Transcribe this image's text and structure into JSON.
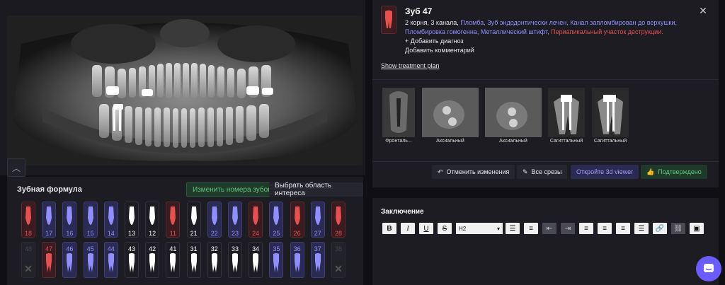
{
  "formula": {
    "title": "Зубная формула",
    "change_numbers_label": "Изменить номера зубов",
    "select_area_label": "Выбрать область интереса",
    "upper": [
      {
        "num": "18",
        "status": "red"
      },
      {
        "num": "17",
        "status": "purple"
      },
      {
        "num": "16",
        "status": "purple"
      },
      {
        "num": "15",
        "status": "purple"
      },
      {
        "num": "14",
        "status": "purple"
      },
      {
        "num": "13",
        "status": "white"
      },
      {
        "num": "12",
        "status": "white"
      },
      {
        "num": "11",
        "status": "red"
      },
      {
        "num": "21",
        "status": "white"
      },
      {
        "num": "22",
        "status": "purple"
      },
      {
        "num": "23",
        "status": "purple"
      },
      {
        "num": "24",
        "status": "red"
      },
      {
        "num": "25",
        "status": "purple"
      },
      {
        "num": "26",
        "status": "red"
      },
      {
        "num": "27",
        "status": "purple"
      },
      {
        "num": "28",
        "status": "red"
      }
    ],
    "lower": [
      {
        "num": "48",
        "status": "missing"
      },
      {
        "num": "47",
        "status": "red"
      },
      {
        "num": "46",
        "status": "purple"
      },
      {
        "num": "45",
        "status": "purple"
      },
      {
        "num": "44",
        "status": "purple"
      },
      {
        "num": "43",
        "status": "white"
      },
      {
        "num": "42",
        "status": "white"
      },
      {
        "num": "41",
        "status": "white"
      },
      {
        "num": "31",
        "status": "white"
      },
      {
        "num": "32",
        "status": "white"
      },
      {
        "num": "33",
        "status": "white"
      },
      {
        "num": "34",
        "status": "white"
      },
      {
        "num": "35",
        "status": "purple"
      },
      {
        "num": "36",
        "status": "purple"
      },
      {
        "num": "37",
        "status": "purple"
      },
      {
        "num": "38",
        "status": "missing"
      }
    ]
  },
  "tooth_card": {
    "title": "Зуб 47",
    "close_icon": "close-icon",
    "roots_text": "2 корня,",
    "canals_text": "3 канала,",
    "tags": [
      {
        "text": "Пломба,",
        "color": "#8f8fff"
      },
      {
        "text": "Зуб эндодонтически лечен,",
        "color": "#8f8fff"
      },
      {
        "text": "Канал запломбирован до верхушки,",
        "color": "#8f8fff"
      },
      {
        "text": "Пломбировка гомогенна,",
        "color": "#8f8fff"
      },
      {
        "text": "Металлический штифт,",
        "color": "#8f8fff"
      },
      {
        "text": "Периапикальный участок деструкции.",
        "color": "#e55050"
      }
    ],
    "add_diagnosis": "+ Добавить диагноз",
    "add_comment": "Добавить комментарий",
    "treatment_plan": "Show treatment plan",
    "slices": [
      {
        "label": "Фронталь..."
      },
      {
        "label": "Аксиальный"
      },
      {
        "label": "Аксиальный"
      },
      {
        "label": "Сагиттальный"
      },
      {
        "label": "Сагиттальный"
      }
    ],
    "actions": {
      "undo": "Отменить изменения",
      "all_slices": "Все срезы",
      "open_3d": "Откройте 3d viewer",
      "confirmed": "Подтверждено"
    }
  },
  "conclusion": {
    "title": "Заключение",
    "heading_select": "H2"
  },
  "colors": {
    "red": "#e55050",
    "purple": "#8f8fff",
    "green": "#5ec87c",
    "accent": "#6b5cff"
  }
}
